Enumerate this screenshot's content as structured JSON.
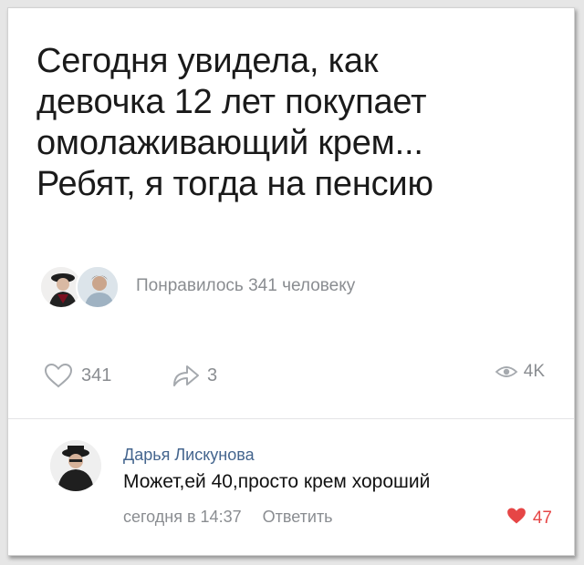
{
  "post": {
    "lines": [
      "Сегодня увидела, как",
      "девочка 12 лет покупает",
      "омолаживающий крем...",
      "Ребят, я тогда на пенсию"
    ]
  },
  "likers": {
    "text": "Понравилось 341 человеку"
  },
  "stats": {
    "likes": "341",
    "shares": "3",
    "views": "4K"
  },
  "comment": {
    "author": "Дарья Лискунова",
    "text": "Может,ей 40,просто крем хороший",
    "time": "сегодня в 14:37",
    "reply": "Ответить",
    "likes": "47"
  },
  "colors": {
    "text": "#1a1a1a",
    "muted": "#8a8d91",
    "author_link": "#44658e",
    "like_red": "#e64646"
  }
}
